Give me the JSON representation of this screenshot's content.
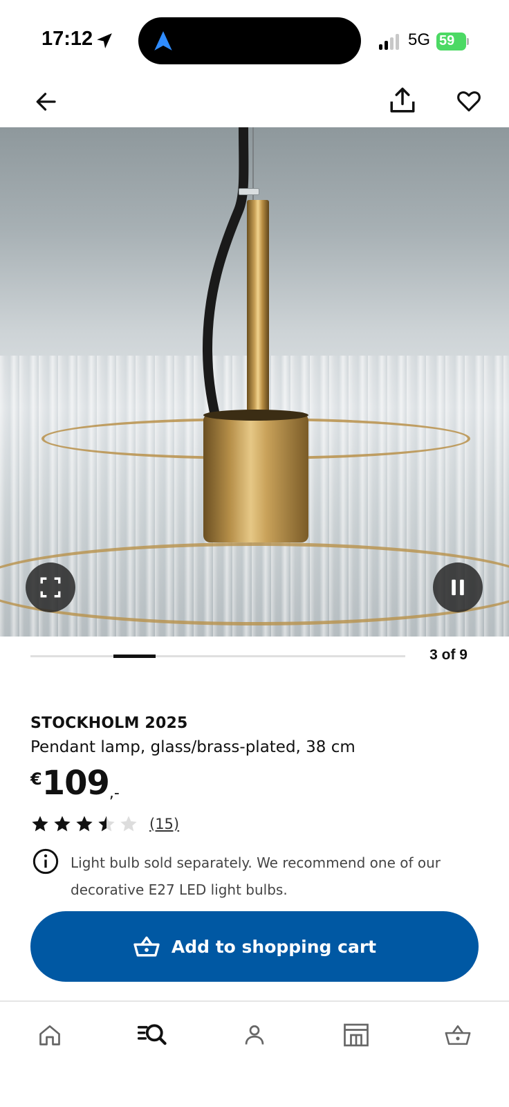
{
  "status_bar": {
    "time": "17:12",
    "network": "5G",
    "battery_percent": "59",
    "icons": [
      "location-arrow-icon",
      "navigation-app-icon",
      "signal-icon",
      "battery-charging-icon"
    ]
  },
  "top_nav": {
    "back_icon": "arrow-left-icon",
    "share_icon": "share-icon",
    "favourite_icon": "heart-icon"
  },
  "gallery": {
    "current": 3,
    "total": 9,
    "counter_label": "3 of 9",
    "fullscreen_icon": "fullscreen-icon",
    "pause_icon": "pause-icon"
  },
  "product": {
    "name": "STOCKHOLM 2025",
    "description": "Pendant lamp, glass/brass-plated, 38 cm",
    "price": {
      "currency": "€",
      "integer": "109",
      "decimal": ",-"
    },
    "rating": {
      "value": 3.5,
      "max": 5,
      "review_count": "(15)"
    },
    "info_note": "Light bulb sold separately. We recommend one of our decorative E27 LED light bulbs."
  },
  "actions": {
    "add_to_cart_label": "Add to shopping cart",
    "add_to_cart_icon": "shopping-basket-icon"
  },
  "bottom_nav": {
    "items": [
      {
        "name": "home",
        "icon": "home-icon"
      },
      {
        "name": "search",
        "icon": "search-menu-icon",
        "active": true
      },
      {
        "name": "profile",
        "icon": "person-icon"
      },
      {
        "name": "store",
        "icon": "store-icon"
      },
      {
        "name": "cart",
        "icon": "shopping-basket-icon"
      }
    ]
  },
  "colors": {
    "primary": "#0058a3",
    "battery": "#4cd964",
    "text": "#111111",
    "star": "#111111",
    "star_empty": "#dddddd"
  }
}
